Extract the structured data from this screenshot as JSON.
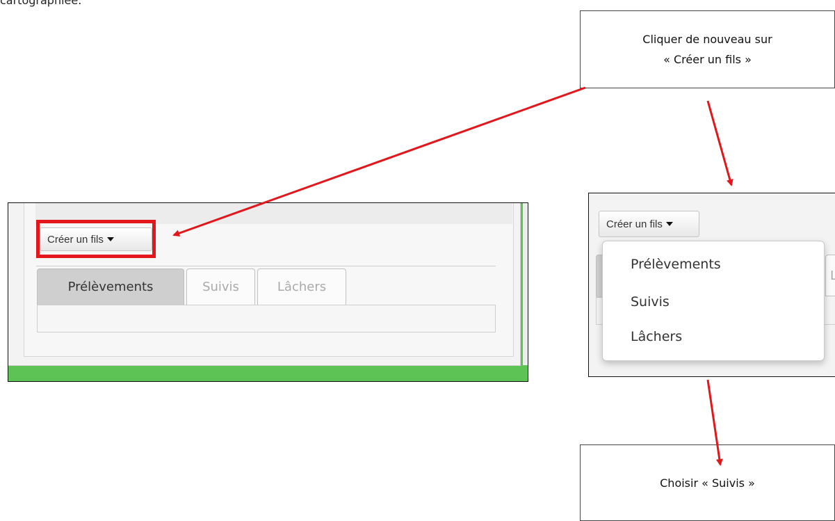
{
  "doc_fragment": "cartographiée.",
  "callouts": {
    "top_line1": "Cliquer de nouveau sur",
    "top_line2": "« Créer un fils »",
    "bottom": "Choisir « Suivis »"
  },
  "left_screenshot": {
    "button_label": "Créer un fils",
    "tabs": [
      "Prélèvements",
      "Suivis",
      "Lâchers"
    ]
  },
  "right_screenshot": {
    "button_label": "Créer un fils",
    "tab_peek": "L",
    "menu_items": [
      "Prélèvements",
      "Suivis",
      "Lâchers"
    ]
  },
  "colors": {
    "arrow": "#e3171b",
    "highlight": "#e3171b",
    "frame_green": "#5cc354"
  }
}
